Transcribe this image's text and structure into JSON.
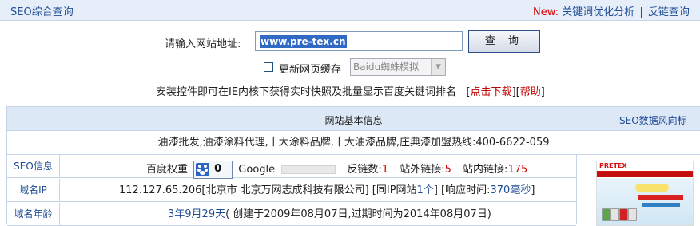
{
  "header": {
    "title": "SEO综合查询",
    "new_label": "New:",
    "link_keyword": "关键词优化分析",
    "separator": "|",
    "link_backlink": "反链查询"
  },
  "search": {
    "label": "请输入网站地址:",
    "value": "www.pre-tex.cn",
    "button": "查 询"
  },
  "refresh": {
    "label": "更新网页缓存",
    "checked": false,
    "select_value": "Baidu蜘蛛模拟"
  },
  "notice": {
    "text": "安装控件即可在IE内核下获得实时快照及批量显示百度关键词排名",
    "lb": "[",
    "download": "点击下载",
    "rb": "]",
    "help_lb": "[",
    "help": "帮助",
    "help_rb": "]"
  },
  "table": {
    "header": "网站基本信息",
    "trend_link": "SEO数据风向标",
    "description": "油漆批发,油漆涂料代理,十大涂料品牌,十大油漆品牌,庄典漆加盟热线:400-6622-059",
    "seo": {
      "label": "SEO信息",
      "baidu_weight_label": "百度权重",
      "baidu_weight_value": "0",
      "google_label": "Google",
      "backlinks_label": "反链数:",
      "backlinks_value": "1",
      "external_label": "站外链接:",
      "external_value": "5",
      "internal_label": "站内链接:",
      "internal_value": "175"
    },
    "ip": {
      "label": "域名IP",
      "address": "112.127.65.206[北京市 北京万网志成科技有限公司]",
      "same_ip_pre": "[同IP网站",
      "same_ip_link": "1个",
      "same_ip_post": "]",
      "resp_pre": "[响应时间:",
      "resp_value": "370毫秒",
      "resp_post": "]"
    },
    "age": {
      "label": "域名年龄",
      "age_value": "3年9月29天",
      "detail": "( 创建于2009年08月07日,过期时间为2014年08月07日)"
    },
    "thumbnail": {
      "logo_text": "PRETEX"
    }
  }
}
